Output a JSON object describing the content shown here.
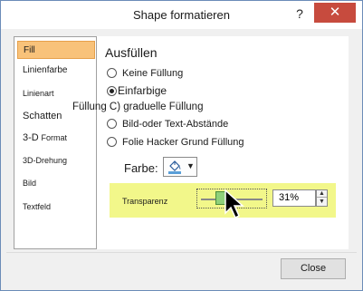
{
  "window": {
    "title": "Shape formatieren",
    "help_label": "?",
    "close_label": "✕"
  },
  "sidebar": {
    "items": [
      {
        "label": "Fill",
        "active": true
      },
      {
        "label": "Linienfarbe"
      },
      {
        "label": "Linienart"
      },
      {
        "label": "Schatten"
      },
      {
        "label": "3-D",
        "label_suffix": "Format"
      },
      {
        "label": "3D-Drehung"
      },
      {
        "label": "Bild"
      },
      {
        "label": "Textfeld"
      }
    ]
  },
  "panel": {
    "heading": "Ausfüllen",
    "options": [
      {
        "label": "Keine Füllung",
        "selected": false
      },
      {
        "label": "Einfarbige",
        "selected": true
      },
      {
        "label": "Füllung C) graduelle Füllung",
        "selected": false
      },
      {
        "label": "Bild-oder Text-Abstände",
        "selected": false
      },
      {
        "label": "Folie Hacker Grund Füllung",
        "selected": false
      }
    ],
    "color_label": "Farbe:",
    "color_dropdown_arrow": "▼",
    "transparency": {
      "label": "Transparenz",
      "value_text": "31%",
      "fraction": 0.31,
      "spin_up": "▲",
      "spin_down": "▼"
    }
  },
  "footer": {
    "close_button": "Close"
  },
  "colors": {
    "active_item": "#f8c27a",
    "highlight": "#f2f78a",
    "titlebar_close": "#c74b3e",
    "slider_thumb": "#8fd07a"
  },
  "icons": {
    "paint_bucket": "paint-bucket-icon",
    "cursor": "mouse-pointer-icon"
  }
}
